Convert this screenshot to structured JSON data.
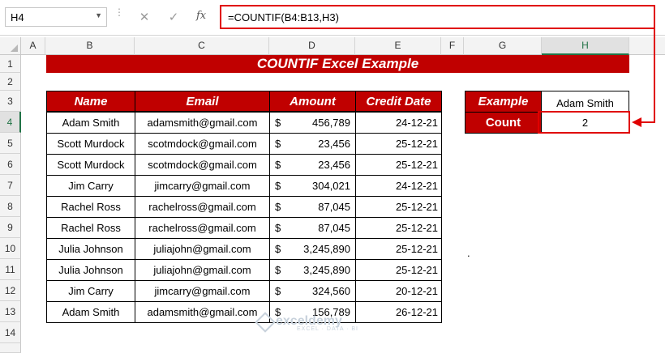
{
  "formula_bar": {
    "name_box": "H4",
    "cancel_icon": "✕",
    "enter_icon": "✓",
    "fx_label": "fx",
    "formula": "=COUNTIF(B4:B13,H3)"
  },
  "columns": [
    "A",
    "B",
    "C",
    "D",
    "E",
    "F",
    "G",
    "H"
  ],
  "rows": [
    "1",
    "2",
    "3",
    "4",
    "5",
    "6",
    "7",
    "8",
    "9",
    "10",
    "11",
    "12",
    "13",
    "14"
  ],
  "title": "COUNTIF Excel Example",
  "table": {
    "headers": [
      "Name",
      "Email",
      "Amount",
      "Credit Date"
    ],
    "rows": [
      {
        "name": "Adam Smith",
        "email": "adamsmith@gmail.com",
        "currency": "$",
        "amount": "456,789",
        "date": "24-12-21"
      },
      {
        "name": "Scott Murdock",
        "email": "scotmdock@gmail.com",
        "currency": "$",
        "amount": "23,456",
        "date": "25-12-21"
      },
      {
        "name": "Scott Murdock",
        "email": "scotmdock@gmail.com",
        "currency": "$",
        "amount": "23,456",
        "date": "25-12-21"
      },
      {
        "name": "Jim Carry",
        "email": "jimcarry@gmail.com",
        "currency": "$",
        "amount": "304,021",
        "date": "24-12-21"
      },
      {
        "name": "Rachel Ross",
        "email": "rachelross@gmail.com",
        "currency": "$",
        "amount": "87,045",
        "date": "25-12-21"
      },
      {
        "name": "Rachel Ross",
        "email": "rachelross@gmail.com",
        "currency": "$",
        "amount": "87,045",
        "date": "25-12-21"
      },
      {
        "name": "Julia Johnson",
        "email": "juliajohn@gmail.com",
        "currency": "$",
        "amount": "3,245,890",
        "date": "25-12-21"
      },
      {
        "name": "Julia Johnson",
        "email": "juliajohn@gmail.com",
        "currency": "$",
        "amount": "3,245,890",
        "date": "25-12-21"
      },
      {
        "name": "Jim Carry",
        "email": "jimcarry@gmail.com",
        "currency": "$",
        "amount": "324,560",
        "date": "20-12-21"
      },
      {
        "name": "Adam Smith",
        "email": "adamsmith@gmail.com",
        "currency": "$",
        "amount": "156,789",
        "date": "26-12-21"
      }
    ]
  },
  "side": {
    "example_label": "Example",
    "example_value": "Adam Smith",
    "count_label": "Count",
    "count_value": "2"
  },
  "stray_text": ".",
  "watermark": {
    "brand": "exceldemy",
    "tagline": "EXCEL · DATA · BI"
  },
  "colors": {
    "accent": "#c00000",
    "highlight": "#e00000",
    "selection": "#217346"
  }
}
